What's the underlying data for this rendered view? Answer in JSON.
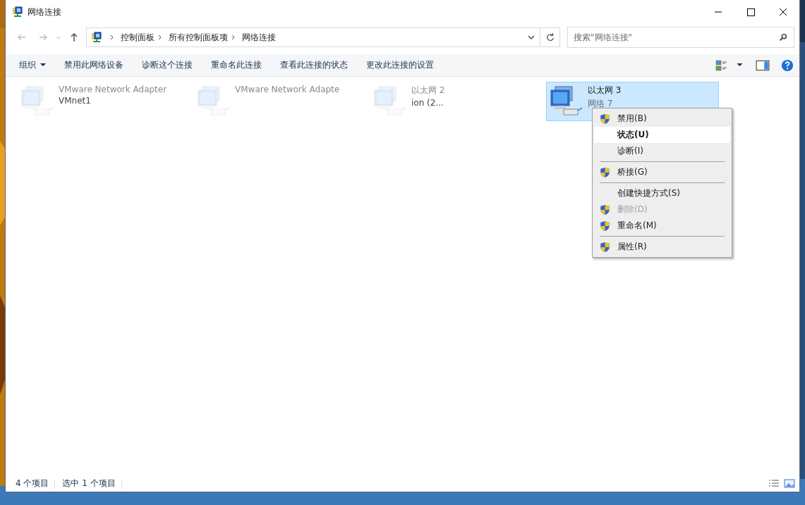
{
  "window": {
    "title": "网络连接"
  },
  "address_bar": {
    "crumbs": [
      "控制面板",
      "所有控制面板项",
      "网络连接"
    ]
  },
  "search": {
    "placeholder": "搜索\"网络连接\""
  },
  "toolbar": {
    "items": [
      {
        "label": "组织",
        "dropdown": true
      },
      {
        "label": "禁用此网络设备",
        "dropdown": false
      },
      {
        "label": "诊断这个连接",
        "dropdown": false
      },
      {
        "label": "重命名此连接",
        "dropdown": false
      },
      {
        "label": "查看此连接的状态",
        "dropdown": false
      },
      {
        "label": "更改此连接的设置",
        "dropdown": false
      }
    ]
  },
  "connections": [
    {
      "name": "VMware Network Adapter",
      "lines": [
        "VMnet1"
      ],
      "faded": true,
      "selected": false
    },
    {
      "name": "VMware Network Adapte",
      "faded": true,
      "selected": false
    },
    {
      "name": "以太网 2",
      "lines": [
        "ion (2..."
      ],
      "faded": true,
      "selected": false
    },
    {
      "name": "以太网 3",
      "lines": [
        "网络 7"
      ],
      "faded": false,
      "selected": true
    }
  ],
  "context_menu": {
    "items": [
      {
        "kind": "item",
        "label": "禁用(B)",
        "shield": true,
        "bold": false,
        "disabled": false,
        "selected": false
      },
      {
        "kind": "item",
        "label": "状态(U)",
        "shield": false,
        "bold": true,
        "disabled": false,
        "selected": true
      },
      {
        "kind": "item",
        "label": "诊断(I)",
        "shield": false,
        "bold": false,
        "disabled": false,
        "selected": false
      },
      {
        "kind": "separator"
      },
      {
        "kind": "item",
        "label": "桥接(G)",
        "shield": true,
        "bold": false,
        "disabled": false,
        "selected": false
      },
      {
        "kind": "separator"
      },
      {
        "kind": "item",
        "label": "创建快捷方式(S)",
        "shield": false,
        "bold": false,
        "disabled": false,
        "selected": false
      },
      {
        "kind": "item",
        "label": "删除(D)",
        "shield": true,
        "bold": false,
        "disabled": true,
        "selected": false
      },
      {
        "kind": "item",
        "label": "重命名(M)",
        "shield": true,
        "bold": false,
        "disabled": false,
        "selected": false
      },
      {
        "kind": "separator"
      },
      {
        "kind": "item",
        "label": "属性(R)",
        "shield": true,
        "bold": false,
        "disabled": false,
        "selected": false
      }
    ]
  },
  "status_bar": {
    "count": "4 个项目",
    "selection": "选中 1 个项目"
  }
}
